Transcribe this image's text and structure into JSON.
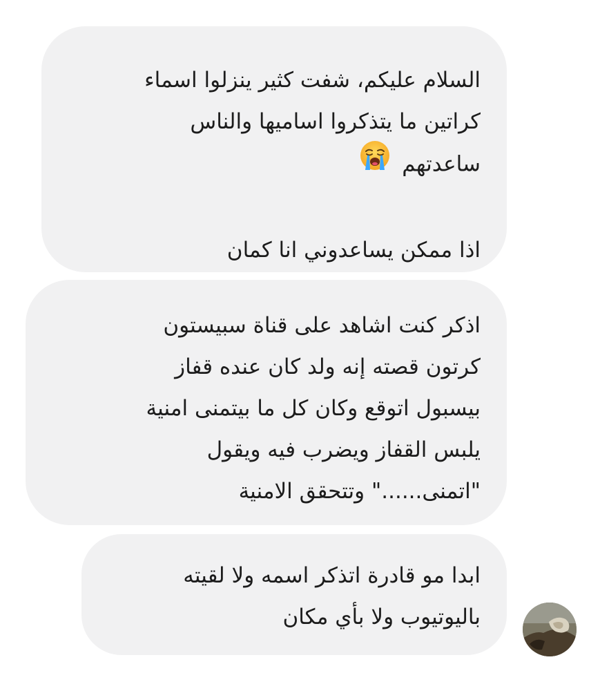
{
  "messages": [
    {
      "lines": [
        "السلام عليكم، شفت كثير ينزلوا اسماء",
        "كراتين ما يتذكروا اساميها والناس",
        "ساعدتهم",
        "",
        "اذا ممكن يساعدوني انا كمان"
      ],
      "emoji": "loudly-crying-face-emoji"
    },
    {
      "lines": [
        "اذكر كنت اشاهد على قناة سبيستون",
        "كرتون قصته إنه ولد كان عنده قفاز",
        "بيسبول اتوقع وكان كل ما بيتمنى امنية",
        "يلبس القفاز ويضرب فيه ويقول",
        "\"اتمنى......\" وتتحقق الامنية"
      ]
    },
    {
      "lines": [
        "ابدا مو قادرة اتذكر اسمه ولا لقيته",
        "باليوتيوب ولا بأي مكان"
      ]
    }
  ],
  "colors": {
    "bubble_background": "#f1f1f2",
    "text": "#1c1c1c",
    "page_background": "#ffffff"
  },
  "avatar": {
    "icon": "user-avatar-photo"
  }
}
